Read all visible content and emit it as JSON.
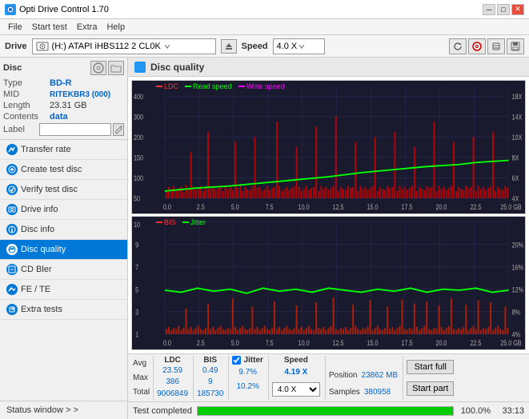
{
  "titlebar": {
    "title": "Opti Drive Control 1.70",
    "minimize": "─",
    "maximize": "□",
    "close": "✕"
  },
  "menubar": {
    "items": [
      "File",
      "Start test",
      "Extra",
      "Help"
    ]
  },
  "drivebar": {
    "label": "Drive",
    "drive_value": "(H:) ATAPI iHBS112  2 CL0K",
    "speed_label": "Speed",
    "speed_value": "4.0 X"
  },
  "disc": {
    "title": "Disc",
    "type_label": "Type",
    "type_value": "BD-R",
    "mid_label": "MID",
    "mid_value": "RITEKBR3 (000)",
    "length_label": "Length",
    "length_value": "23.31 GB",
    "contents_label": "Contents",
    "contents_value": "data",
    "label_label": "Label"
  },
  "sidebar": {
    "items": [
      {
        "label": "Transfer rate",
        "id": "transfer-rate"
      },
      {
        "label": "Create test disc",
        "id": "create-test-disc"
      },
      {
        "label": "Verify test disc",
        "id": "verify-test-disc"
      },
      {
        "label": "Drive info",
        "id": "drive-info"
      },
      {
        "label": "Disc info",
        "id": "disc-info"
      },
      {
        "label": "Disc quality",
        "id": "disc-quality",
        "active": true
      },
      {
        "label": "CD Bler",
        "id": "cd-bler"
      },
      {
        "label": "FE / TE",
        "id": "fe-te"
      },
      {
        "label": "Extra tests",
        "id": "extra-tests"
      }
    ],
    "status_window": "Status window > >"
  },
  "disc_quality": {
    "title": "Disc quality",
    "chart1": {
      "legend": [
        {
          "label": "LDC",
          "color": "#ff4444"
        },
        {
          "label": "Read speed",
          "color": "#00ff00"
        },
        {
          "label": "Write speed",
          "color": "#ff00ff"
        }
      ],
      "y_max": 400,
      "y_right_max": 18,
      "x_max": 25.0,
      "x_labels": [
        "0.0",
        "2.5",
        "5.0",
        "7.5",
        "10.0",
        "12.5",
        "15.0",
        "17.5",
        "20.0",
        "22.5",
        "25.0 GB"
      ],
      "y_left_labels": [
        "50",
        "100",
        "150",
        "200",
        "250",
        "300",
        "350",
        "400"
      ],
      "y_right_labels": [
        "4X",
        "6X",
        "8X",
        "10X",
        "12X",
        "14X",
        "16X",
        "18X"
      ]
    },
    "chart2": {
      "legend": [
        {
          "label": "BIS",
          "color": "#ff4444"
        },
        {
          "label": "Jitter",
          "color": "#00ff00"
        }
      ],
      "y_max": 10,
      "y_right_max": 20,
      "x_labels": [
        "0.0",
        "2.5",
        "5.0",
        "7.5",
        "10.0",
        "12.5",
        "15.0",
        "17.5",
        "20.0",
        "22.5",
        "25.0 GB"
      ],
      "y_left_labels": [
        "1",
        "2",
        "3",
        "4",
        "5",
        "6",
        "7",
        "8",
        "9",
        "10"
      ],
      "y_right_labels": [
        "4%",
        "8%",
        "12%",
        "16%",
        "20%"
      ]
    }
  },
  "stats": {
    "headers": {
      "ldc": "LDC",
      "bis": "BIS",
      "jitter": "Jitter",
      "speed": "Speed",
      "position": ""
    },
    "avg_label": "Avg",
    "max_label": "Max",
    "total_label": "Total",
    "avg_ldc": "23.59",
    "avg_bis": "0.49",
    "avg_jitter": "9.7%",
    "avg_speed": "4.19 X",
    "max_ldc": "386",
    "max_bis": "9",
    "max_jitter": "10.2%",
    "speed_dropdown": "4.0 X",
    "total_ldc": "9006849",
    "total_bis": "185730",
    "position_label": "Position",
    "position_value": "23862 MB",
    "samples_label": "Samples",
    "samples_value": "380958",
    "start_full": "Start full",
    "start_part": "Start part",
    "jitter_checkbox": "✓",
    "jitter_label": "Jitter"
  },
  "statusbar": {
    "status": "Test completed",
    "progress": 100,
    "progress_text": "100.0%",
    "time": "33:13"
  },
  "colors": {
    "active_nav": "#0078d7",
    "chart_bg": "#1a1a2e",
    "grid": "#2a2a4a",
    "ldc_color": "#ff3333",
    "read_speed_color": "#00ff00",
    "bis_color": "#ff3333",
    "jitter_color": "#00ff00",
    "accent": "#0066cc"
  }
}
